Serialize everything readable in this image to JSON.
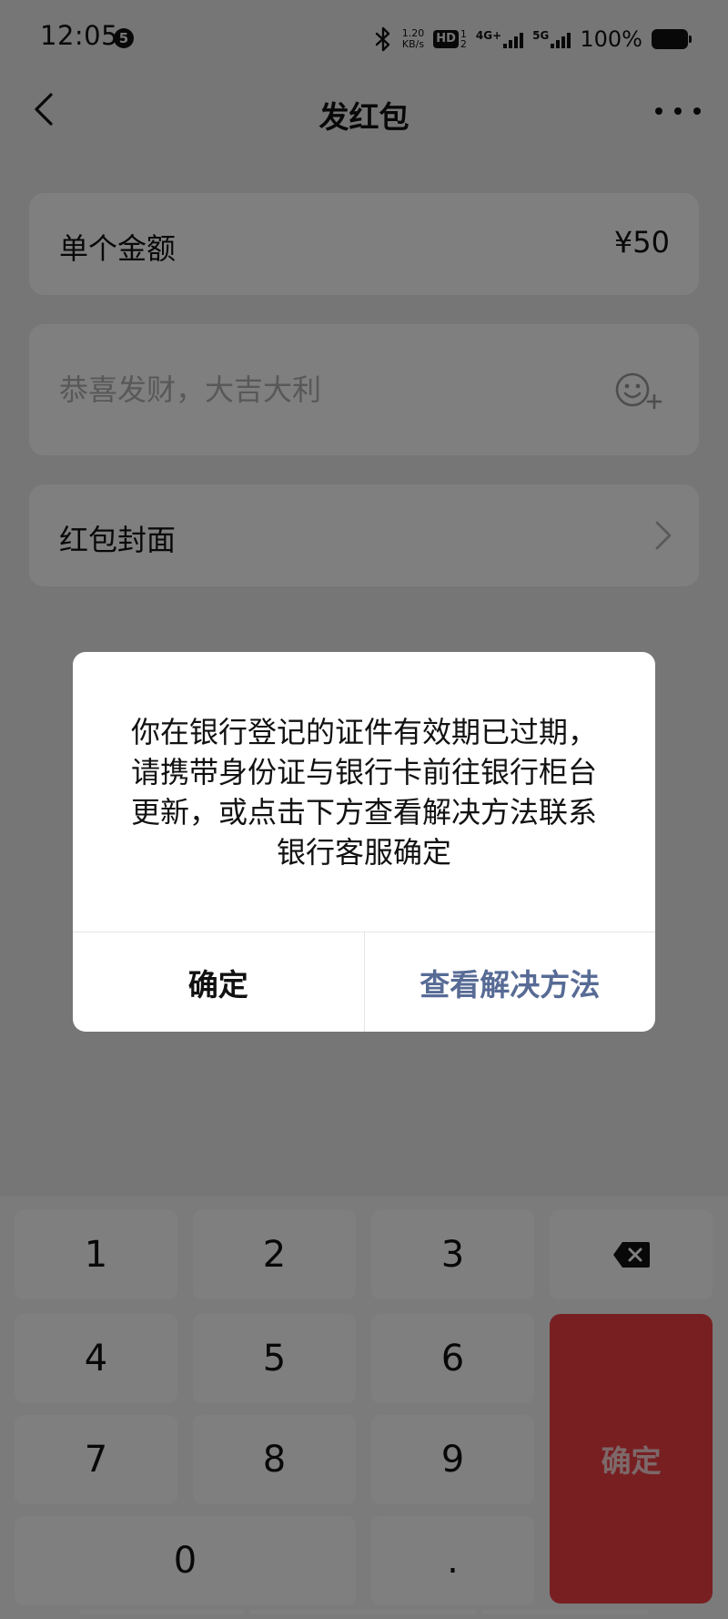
{
  "status_bar": {
    "time": "12:05",
    "notification_badge": "5",
    "net_speed_value": "1.20",
    "net_speed_unit": "KB/s",
    "hd_label": "HD",
    "hd_sim_top": "1",
    "hd_sim_bottom": "2",
    "network_1": "4G+",
    "network_2": "5G",
    "battery_percent": "100%"
  },
  "nav": {
    "title": "发红包"
  },
  "form": {
    "amount_label": "单个金额",
    "amount_value": "¥50",
    "greeting_placeholder": "恭喜发财，大吉大利",
    "cover_label": "红包封面"
  },
  "keypad": {
    "keys": [
      "1",
      "2",
      "3",
      "4",
      "5",
      "6",
      "7",
      "8",
      "9",
      "0",
      "."
    ],
    "confirm_label": "确定"
  },
  "dialog": {
    "message": "你在银行登记的证件有效期已过期，请携带身份证与银行卡前往银行柜台更新，或点击下方查看解决方法联系银行客服确定",
    "confirm_label": "确定",
    "solution_label": "查看解决方法"
  },
  "colors": {
    "page_background": "#ededed",
    "card_background": "#ffffff",
    "keypad_background": "#f7f7f7",
    "confirm_key": "#f03f44",
    "dialog_link": "#576b95",
    "overlay": "rgba(0,0,0,0.5)"
  },
  "icons": [
    "bluetooth-icon",
    "back-arrow-icon",
    "more-dots-icon",
    "emoji-add-icon",
    "chevron-right-icon",
    "backspace-icon",
    "battery-icon",
    "signal-icon"
  ]
}
